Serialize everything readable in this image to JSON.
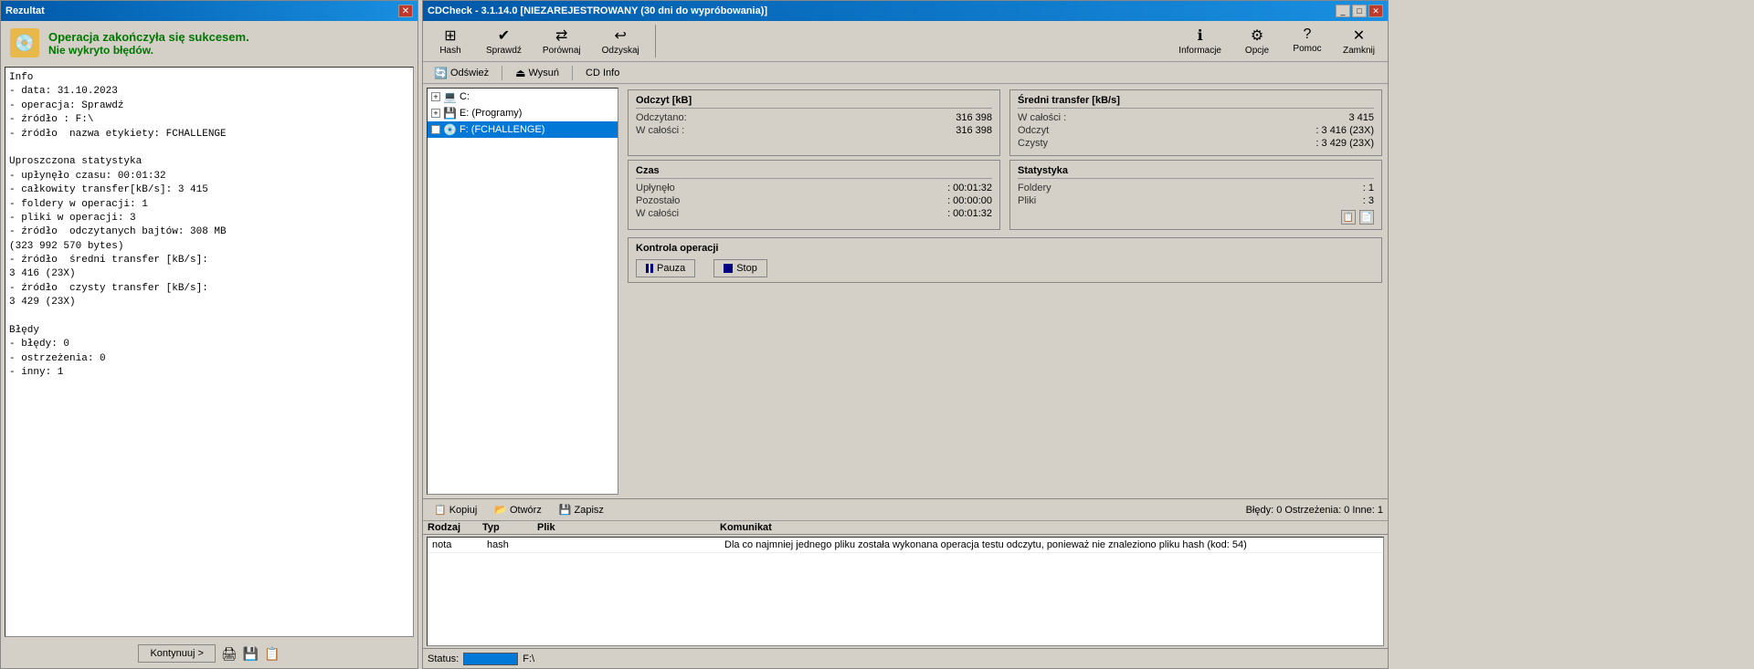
{
  "result_window": {
    "title": "Rezultat",
    "icon": "💿",
    "success_line1": "Operacja zakończyła się sukcesem.",
    "success_line2": "Nie wykryto błędów.",
    "content": "Info\n- data: 31.10.2023\n- operacja: Sprawdź\n- źródło : F:\\\n- źródło  nazwa etykiety: FCHALLENGE\n\nUproszczona statystyka\n- upłynęło czasu: 00:01:32\n- całkowity transfer[kB/s]: 3 415\n- foldery w operacji: 1\n- pliki w operacji: 3\n- źródło  odczytanych bajtów: 308 MB\n(323 992 570 bytes)\n- źródło  średni transfer [kB/s]:\n3 416 (23X)\n- źródło  czysty transfer [kB/s]:\n3 429 (23X)\n\nBłędy\n- błędy: 0\n- ostrzeżenia: 0\n- inny: 1",
    "footer_btn": "Kontynuuj >",
    "close_icon": "✕"
  },
  "main_window": {
    "title": "CDCheck - 3.1.14.0 [NIEZAREJESTROWANY (30 dni do wypróbowania)]",
    "toolbar": {
      "items": [
        {
          "id": "hash",
          "icon": "⊞",
          "label": "Hash"
        },
        {
          "id": "sprawdz",
          "icon": "✔",
          "label": "Sprawdź"
        },
        {
          "id": "porownaj",
          "icon": "⇄",
          "label": "Porównaj"
        },
        {
          "id": "odzyskaj",
          "icon": "↩",
          "label": "Odzyskaj"
        }
      ],
      "right_items": [
        {
          "id": "informacje",
          "icon": "ℹ",
          "label": "Informacje"
        },
        {
          "id": "opcje",
          "icon": "⚙",
          "label": "Opcje"
        },
        {
          "id": "pomoc",
          "icon": "?",
          "label": "Pomoc"
        },
        {
          "id": "zamknij",
          "icon": "✕",
          "label": "Zamknij"
        }
      ]
    },
    "sec_toolbar": {
      "odswierz": "Odśwież",
      "wysun": "Wysuń",
      "cd_info": "CD Info"
    },
    "file_tree": {
      "items": [
        {
          "level": 0,
          "expand": "+",
          "icon": "💻",
          "label": "C:",
          "selected": false
        },
        {
          "level": 0,
          "expand": "+",
          "icon": "💾",
          "label": "E: (Programy)",
          "selected": false
        },
        {
          "level": 0,
          "expand": "+",
          "icon": "💿",
          "label": "F: (FCHALLENGE)",
          "selected": true
        }
      ]
    },
    "stats": {
      "odczyt": {
        "title": "Odczyt [kB]",
        "lines": [
          {
            "label": "Odczytano:",
            "value": "316 398"
          },
          {
            "label": "W całości :",
            "value": "316 398"
          }
        ]
      },
      "sredni_transfer": {
        "title": "Średni transfer [kB/s]",
        "lines": [
          {
            "label": "W całości :",
            "value": "3 415"
          },
          {
            "label": "Odczyt",
            "value": ": 3 416 (23X)"
          },
          {
            "label": "Czysty",
            "value": ": 3 429 (23X)"
          }
        ]
      },
      "czas": {
        "title": "Czas",
        "lines": [
          {
            "label": "Upłynęło",
            "value": ": 00:01:32"
          },
          {
            "label": "Pozostało",
            "value": ": 00:00:00"
          },
          {
            "label": "W całości",
            "value": ": 00:01:32"
          }
        ]
      },
      "statystyka": {
        "title": "Statystyka",
        "lines": [
          {
            "label": "Foldery",
            "value": ": 1"
          },
          {
            "label": "Pliki",
            "value": ": 3"
          }
        ]
      },
      "kontrola": {
        "title": "Kontrola operacji",
        "pause_label": "Pauza",
        "stop_label": "Stop"
      }
    },
    "messages": {
      "toolbar": {
        "kopiuj": "Kopiuj",
        "otworz": "Otwórz",
        "zapisz": "Zapisz",
        "status": "Błędy: 0  Ostrzeżenia: 0  Inne: 1"
      },
      "columns": [
        "Rodzaj",
        "Typ",
        "Plik",
        "Komunikat"
      ],
      "rows": [
        {
          "rodzaj": "nota",
          "typ": "hash",
          "plik": "",
          "komunikat": "Dla co najmniej jednego pliku została wykonana operacja testu odczytu, ponieważ nie znaleziono pliku hash (kod: 54)"
        }
      ]
    },
    "status_bar": {
      "label": "Status:",
      "path": "F:\\"
    }
  }
}
